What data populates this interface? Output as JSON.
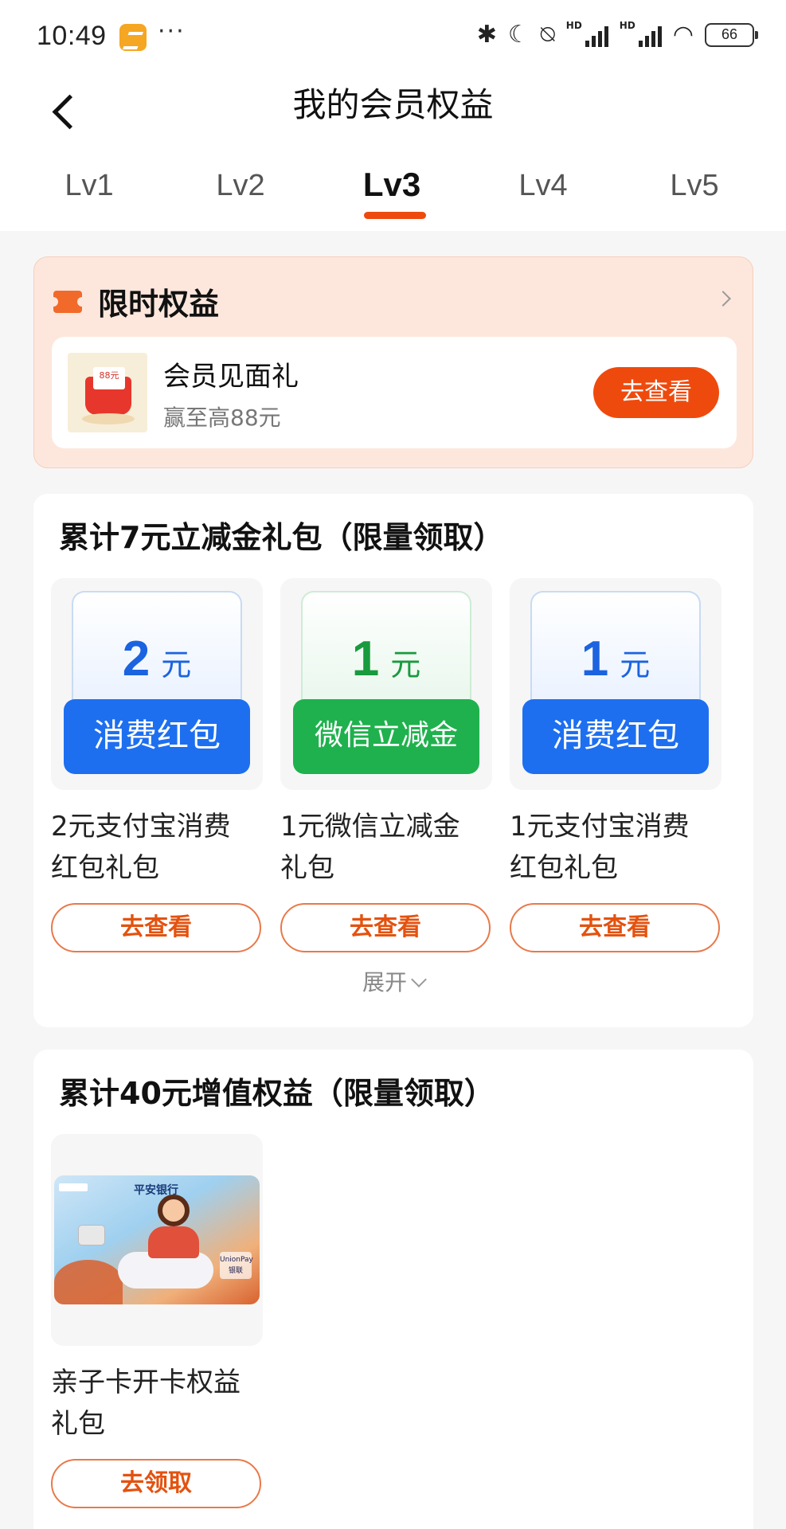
{
  "status_bar": {
    "time": "10:49",
    "more": "···",
    "hd_label": "HD",
    "battery": "66",
    "icons": [
      "app-icon",
      "bluetooth-icon",
      "moon-icon",
      "mute-icon",
      "signal-icon",
      "signal-icon",
      "wifi-icon",
      "battery-icon"
    ]
  },
  "header": {
    "title": "我的会员权益"
  },
  "tabs": [
    {
      "label": "Lv1",
      "active": false
    },
    {
      "label": "Lv2",
      "active": false
    },
    {
      "label": "Lv3",
      "active": true
    },
    {
      "label": "Lv4",
      "active": false
    },
    {
      "label": "Lv5",
      "active": false
    }
  ],
  "limited": {
    "title": "限时权益",
    "gift": {
      "image_text": "88元",
      "name": "会员见面礼",
      "subtitle": "赢至高88元",
      "button": "去查看"
    }
  },
  "section1": {
    "title": "累计7元立减金礼包（限量领取）",
    "items": [
      {
        "amount": "2",
        "unit": "元",
        "band": "消费红包",
        "name_line1": "2元支付宝消费",
        "name_line2": "红包礼包",
        "button": "去查看"
      },
      {
        "amount": "1",
        "unit": "元",
        "band": "微信立减金",
        "name_line1": "1元微信立减金",
        "name_line2": "礼包",
        "button": "去查看"
      },
      {
        "amount": "1",
        "unit": "元",
        "band": "消费红包",
        "name_line1": "1元支付宝消费",
        "name_line2": "红包礼包",
        "button": "去查看"
      }
    ],
    "expand": "展开"
  },
  "section2": {
    "title": "累计40元增值权益（限量领取）",
    "items": [
      {
        "card_bank": "平安银行",
        "card_union": "UnionPay 银联",
        "name_line1": "亲子卡开卡权益",
        "name_line2": "礼包",
        "button": "去领取"
      }
    ]
  },
  "colors": {
    "accent": "#ef4a0d",
    "blue_coupon": "#1d6ff0",
    "green_coupon": "#1fb14d",
    "limited_bg": "#fde7dd"
  }
}
